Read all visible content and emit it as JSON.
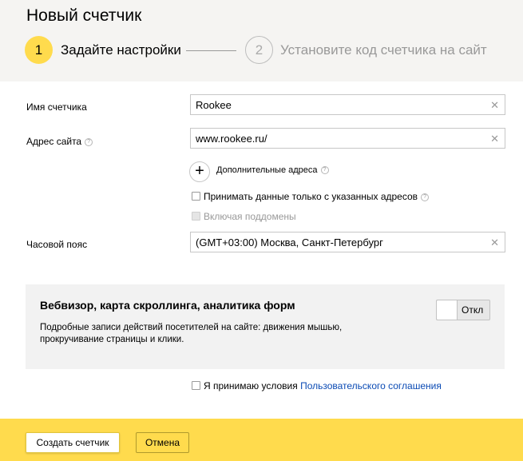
{
  "page_title": "Новый счетчик",
  "steps": [
    {
      "number": "1",
      "label": "Задайте настройки"
    },
    {
      "number": "2",
      "label": "Установите код счетчика на сайт"
    }
  ],
  "form": {
    "counter_name_label": "Имя счетчика",
    "counter_name_value": "Rookee",
    "site_address_label": "Адрес сайта",
    "site_address_value": "www.rookee.ru/",
    "additional_addresses_label": "Дополнительные адреса",
    "accept_only_label": "Принимать данные только с указанных адресов",
    "include_subdomains_label": "Включая поддомены",
    "timezone_label": "Часовой пояс",
    "timezone_value": "(GMT+03:00) Москва, Санкт-Петербург",
    "clear_symbol": "✕",
    "help_symbol": "?",
    "plus_symbol": "+"
  },
  "webvisor": {
    "title": "Вебвизор, карта скроллинга, аналитика форм",
    "description": "Подробные записи действий посетителей на сайте: движения мышью, прокручивание страницы и клики.",
    "toggle_label": "Откл",
    "toggle_state": "off"
  },
  "terms": {
    "text": "Я принимаю условия ",
    "link_text": "Пользовательского соглашения"
  },
  "footer": {
    "create_label": "Создать счетчик",
    "cancel_label": "Отмена"
  },
  "colors": {
    "accent_yellow": "#ffdb4d",
    "header_bg": "#f5f4f2",
    "link_blue": "#0a4ab4"
  }
}
